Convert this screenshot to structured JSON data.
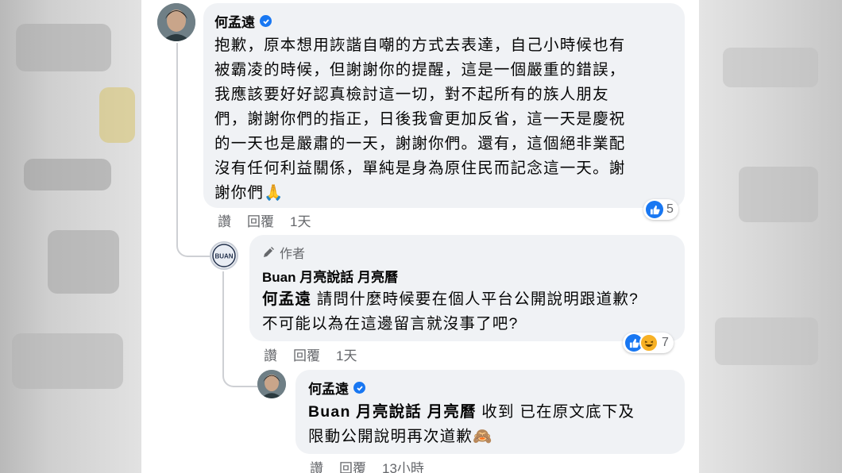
{
  "comments": [
    {
      "author": "何孟遠",
      "verified": true,
      "lines": [
        "抱歉，原本想用詼諧自嘲的方式去表達，自己小時候也有",
        "被霸凌的時候，但謝謝你的提醒，這是一個嚴重的錯誤，",
        "我應該要好好認真檢討這一切，對不起所有的族人朋友",
        "們，謝謝你們的指正，日後我會更加反省，這一天是慶祝",
        "的一天也是嚴肅的一天，謝謝你們。還有，這個絕非業配",
        "沒有任何利益關係，單純是身為原住民而記念這一天。謝",
        "謝你們"
      ],
      "emoji": "🙏",
      "actions": {
        "like": "讚",
        "reply": "回覆",
        "time": "1天"
      },
      "reaction_count": "5"
    },
    {
      "author_tag": "作者",
      "author": "Buan 月亮說話 月亮曆",
      "mention": "何孟遠",
      "line1": " 請問什麼時候要在個人平台公開說明跟道歉?",
      "line2": "不可能以為在這邊留言就沒事了吧?",
      "avatar_text": "BUAN",
      "actions": {
        "like": "讚",
        "reply": "回覆",
        "time": "1天"
      },
      "reaction_count": "7"
    },
    {
      "author": "何孟遠",
      "verified": true,
      "mention": "Buan 月亮說話 月亮曆",
      "line1": " 收到 已在原文底下及",
      "line2": "限動公開說明再次道歉",
      "emoji": "🙈",
      "actions": {
        "like": "讚",
        "reply": "回覆",
        "time": "13小時"
      }
    }
  ],
  "colors": {
    "bubble": "#f0f2f5",
    "verified": "#1877f2",
    "meta_text": "#65676b"
  }
}
